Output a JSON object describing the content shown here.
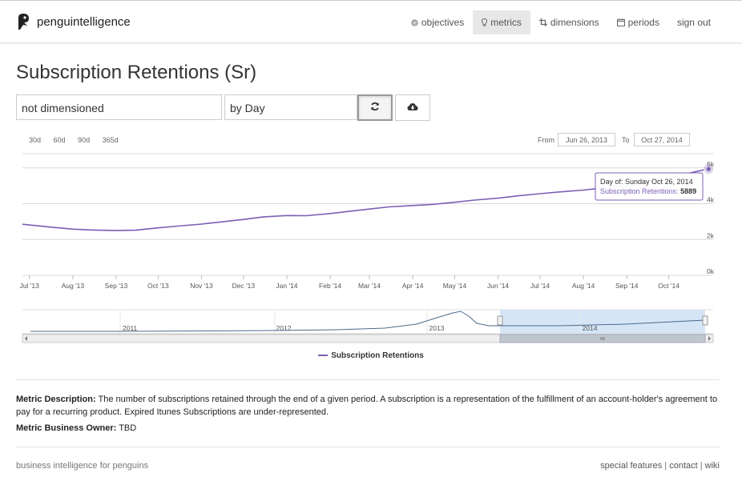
{
  "brand": {
    "name": "penguintelligence"
  },
  "nav": [
    {
      "label": "objectives",
      "icon": "target-icon"
    },
    {
      "label": "metrics",
      "icon": "lightbulb-icon",
      "active": true
    },
    {
      "label": "dimensions",
      "icon": "crop-icon"
    },
    {
      "label": "periods",
      "icon": "calendar-icon"
    },
    {
      "label": "sign out"
    }
  ],
  "page": {
    "title": "Subscription Retentions (Sr)"
  },
  "controls": {
    "dimension_value": "not dimensioned",
    "period_value": "by Day",
    "refresh_icon": "refresh-icon",
    "download_icon": "cloud-download-icon"
  },
  "range_buttons": [
    "30d",
    "60d",
    "90d",
    "365d"
  ],
  "date_range": {
    "from_label": "From",
    "from": "Jun 26, 2013",
    "to_label": "To",
    "to": "Oct 27, 2014"
  },
  "chart_data": {
    "type": "line",
    "series": [
      {
        "name": "Subscription Retentions",
        "color": "#7b5fb5",
        "points": [
          [
            "2013-06-26",
            2850
          ],
          [
            "2013-07-15",
            2700
          ],
          [
            "2013-08-01",
            2580
          ],
          [
            "2013-08-15",
            2530
          ],
          [
            "2013-09-01",
            2500
          ],
          [
            "2013-09-15",
            2520
          ],
          [
            "2013-10-01",
            2650
          ],
          [
            "2013-10-15",
            2750
          ],
          [
            "2013-11-01",
            2860
          ],
          [
            "2013-11-15",
            2980
          ],
          [
            "2013-12-01",
            3120
          ],
          [
            "2013-12-15",
            3260
          ],
          [
            "2014-01-01",
            3340
          ],
          [
            "2014-01-15",
            3330
          ],
          [
            "2014-02-01",
            3450
          ],
          [
            "2014-02-15",
            3580
          ],
          [
            "2014-03-01",
            3700
          ],
          [
            "2014-03-15",
            3820
          ],
          [
            "2014-04-01",
            3900
          ],
          [
            "2014-04-15",
            3960
          ],
          [
            "2014-05-01",
            4080
          ],
          [
            "2014-05-15",
            4200
          ],
          [
            "2014-06-01",
            4310
          ],
          [
            "2014-06-15",
            4440
          ],
          [
            "2014-07-01",
            4560
          ],
          [
            "2014-07-15",
            4660
          ],
          [
            "2014-08-01",
            4760
          ],
          [
            "2014-08-15",
            4880
          ],
          [
            "2014-09-01",
            5000
          ],
          [
            "2014-09-15",
            5200
          ],
          [
            "2014-10-01",
            5450
          ],
          [
            "2014-10-15",
            5700
          ],
          [
            "2014-10-26",
            5889
          ]
        ]
      }
    ],
    "x_ticks": [
      "Jul '13",
      "Aug '13",
      "Sep '13",
      "Oct '13",
      "Nov '13",
      "Dec '13",
      "Jan '14",
      "Feb '14",
      "Mar '14",
      "Apr '14",
      "May '14",
      "Jun '14",
      "Jul '14",
      "Aug '14",
      "Sep '14",
      "Oct '14"
    ],
    "y_ticks": [
      "0k",
      "2k",
      "4k",
      "6k"
    ],
    "ylim": [
      0,
      6000
    ],
    "grid": true,
    "tooltip": {
      "title": "Day of: Sunday Oct 26, 2014",
      "series_label": "Subscription Retentions",
      "value": "5889"
    },
    "navigator": {
      "years": [
        "2011",
        "2012",
        "2013",
        "2014"
      ]
    }
  },
  "legend": {
    "label": "Subscription Retentions"
  },
  "description": {
    "label": "Metric Description:",
    "text": "The number of subscriptions retained through the end of a given period. A subscription is a representation of the fulfillment of an account-holder's agreement to pay for a recurring product. Expired Itunes Subscriptions are under-represented."
  },
  "owner": {
    "label": "Metric Business Owner:",
    "value": "TBD"
  },
  "footer": {
    "tagline": "business intelligence for penguins",
    "links": [
      "special features",
      "contact",
      "wiki"
    ]
  }
}
